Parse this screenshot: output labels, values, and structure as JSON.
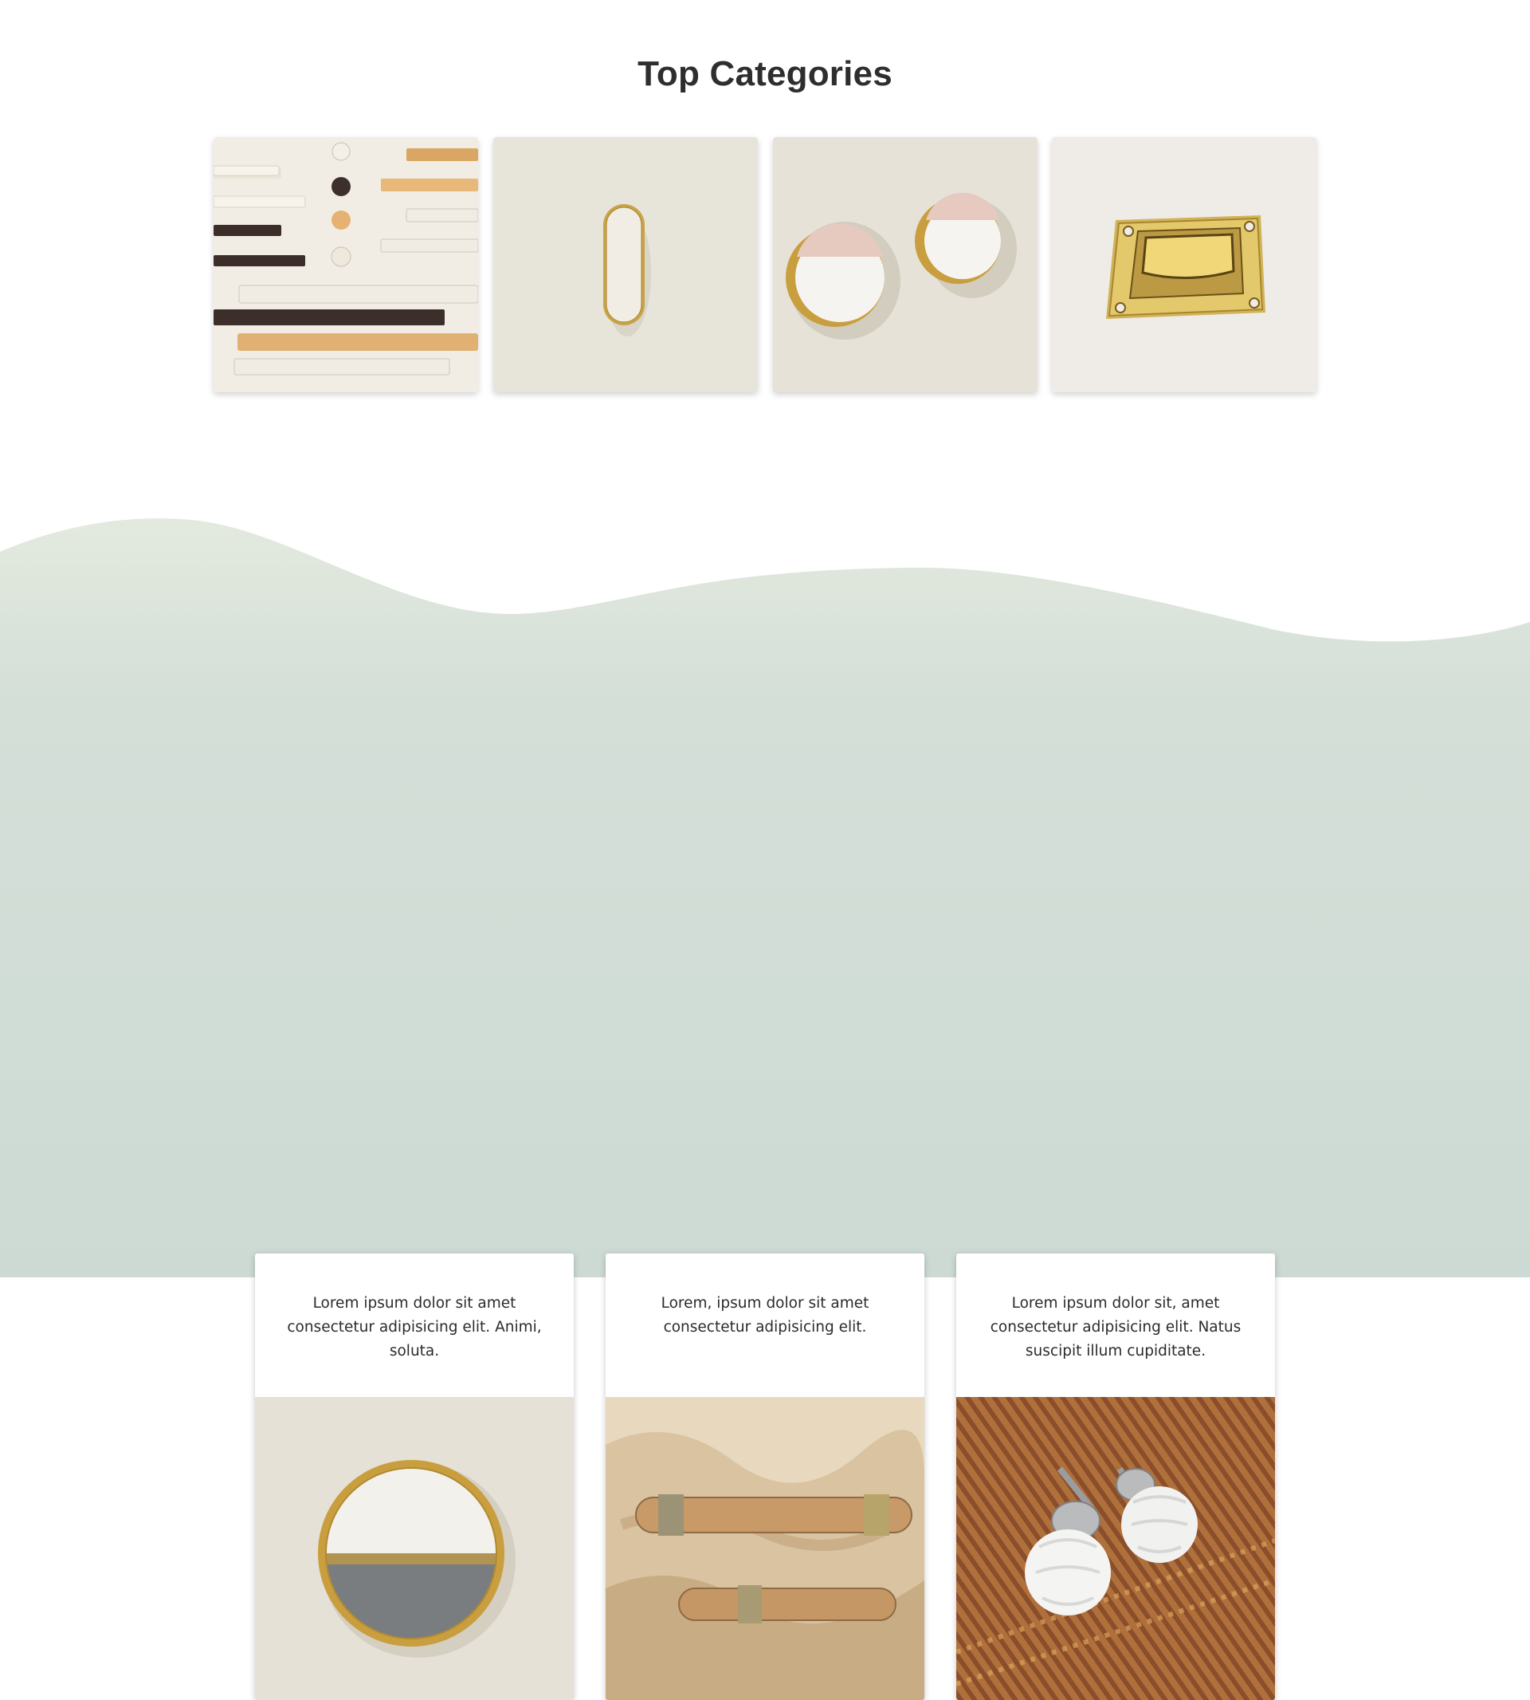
{
  "top_categories": {
    "title": "Top Categories",
    "tiles": [
      {
        "name": "assorted-bar-pulls-and-knobs"
      },
      {
        "name": "oval-brass-knob"
      },
      {
        "name": "round-marble-brass-knobs"
      },
      {
        "name": "brass-flush-ring-pull"
      }
    ]
  },
  "features": {
    "cards": [
      {
        "text": "Lorem ipsum dolor sit amet consectetur adipisicing elit. Animi, soluta."
      },
      {
        "text": "Lorem, ipsum dolor sit amet consectetur adipisicing elit."
      },
      {
        "text": "Lorem ipsum dolor sit, amet consectetur adipisicing elit. Natus suscipit illum cupiditate."
      }
    ]
  },
  "colors": {
    "heading": "#2e2e2e",
    "wave_top": "#e4eadf",
    "wave_bottom": "#cddad4",
    "brass": "#c9a347"
  }
}
